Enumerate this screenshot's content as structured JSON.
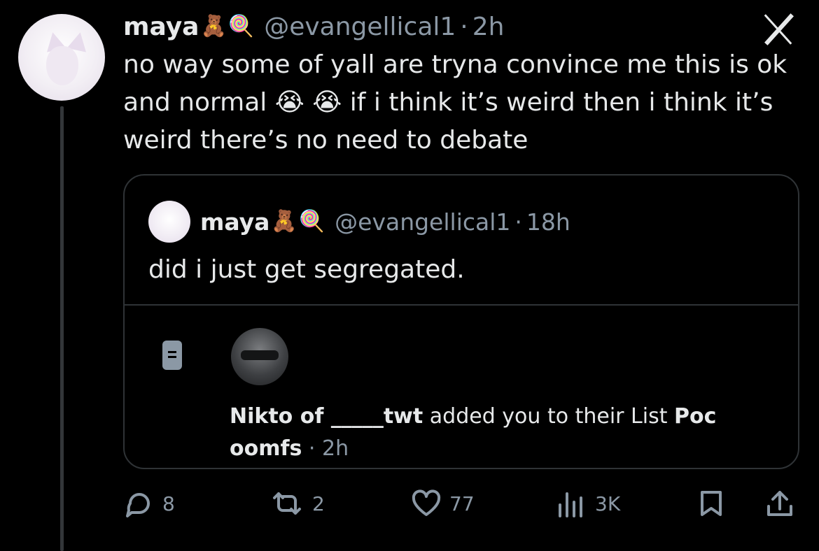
{
  "tweet": {
    "author_name": "maya",
    "name_emojis": [
      "🧸",
      "🍭"
    ],
    "handle": "@evangellical1",
    "separator": "·",
    "time": "2h",
    "text": "no way some of yall are tryna convince me this is ok and normal 😭 😭  if i think it’s weird then i think it’s weird there’s no need to debate"
  },
  "quoted": {
    "author_name": "maya",
    "name_emojis": [
      "🧸",
      "🍭"
    ],
    "handle": "@evangellical1",
    "separator": "·",
    "time": "18h",
    "text": "did i just get segregated."
  },
  "notification": {
    "actor": "Nikto of _____twt",
    "message": " added you to their List ",
    "list_name": "Poc oomfs",
    "separator": " · ",
    "time": "2h"
  },
  "actions": {
    "replies": "8",
    "reposts": "2",
    "likes": "77",
    "views": "3K"
  },
  "icons": [
    "x-logo-icon",
    "reply-icon",
    "repost-icon",
    "like-icon",
    "views-icon",
    "bookmark-icon",
    "share-icon",
    "list-icon"
  ]
}
